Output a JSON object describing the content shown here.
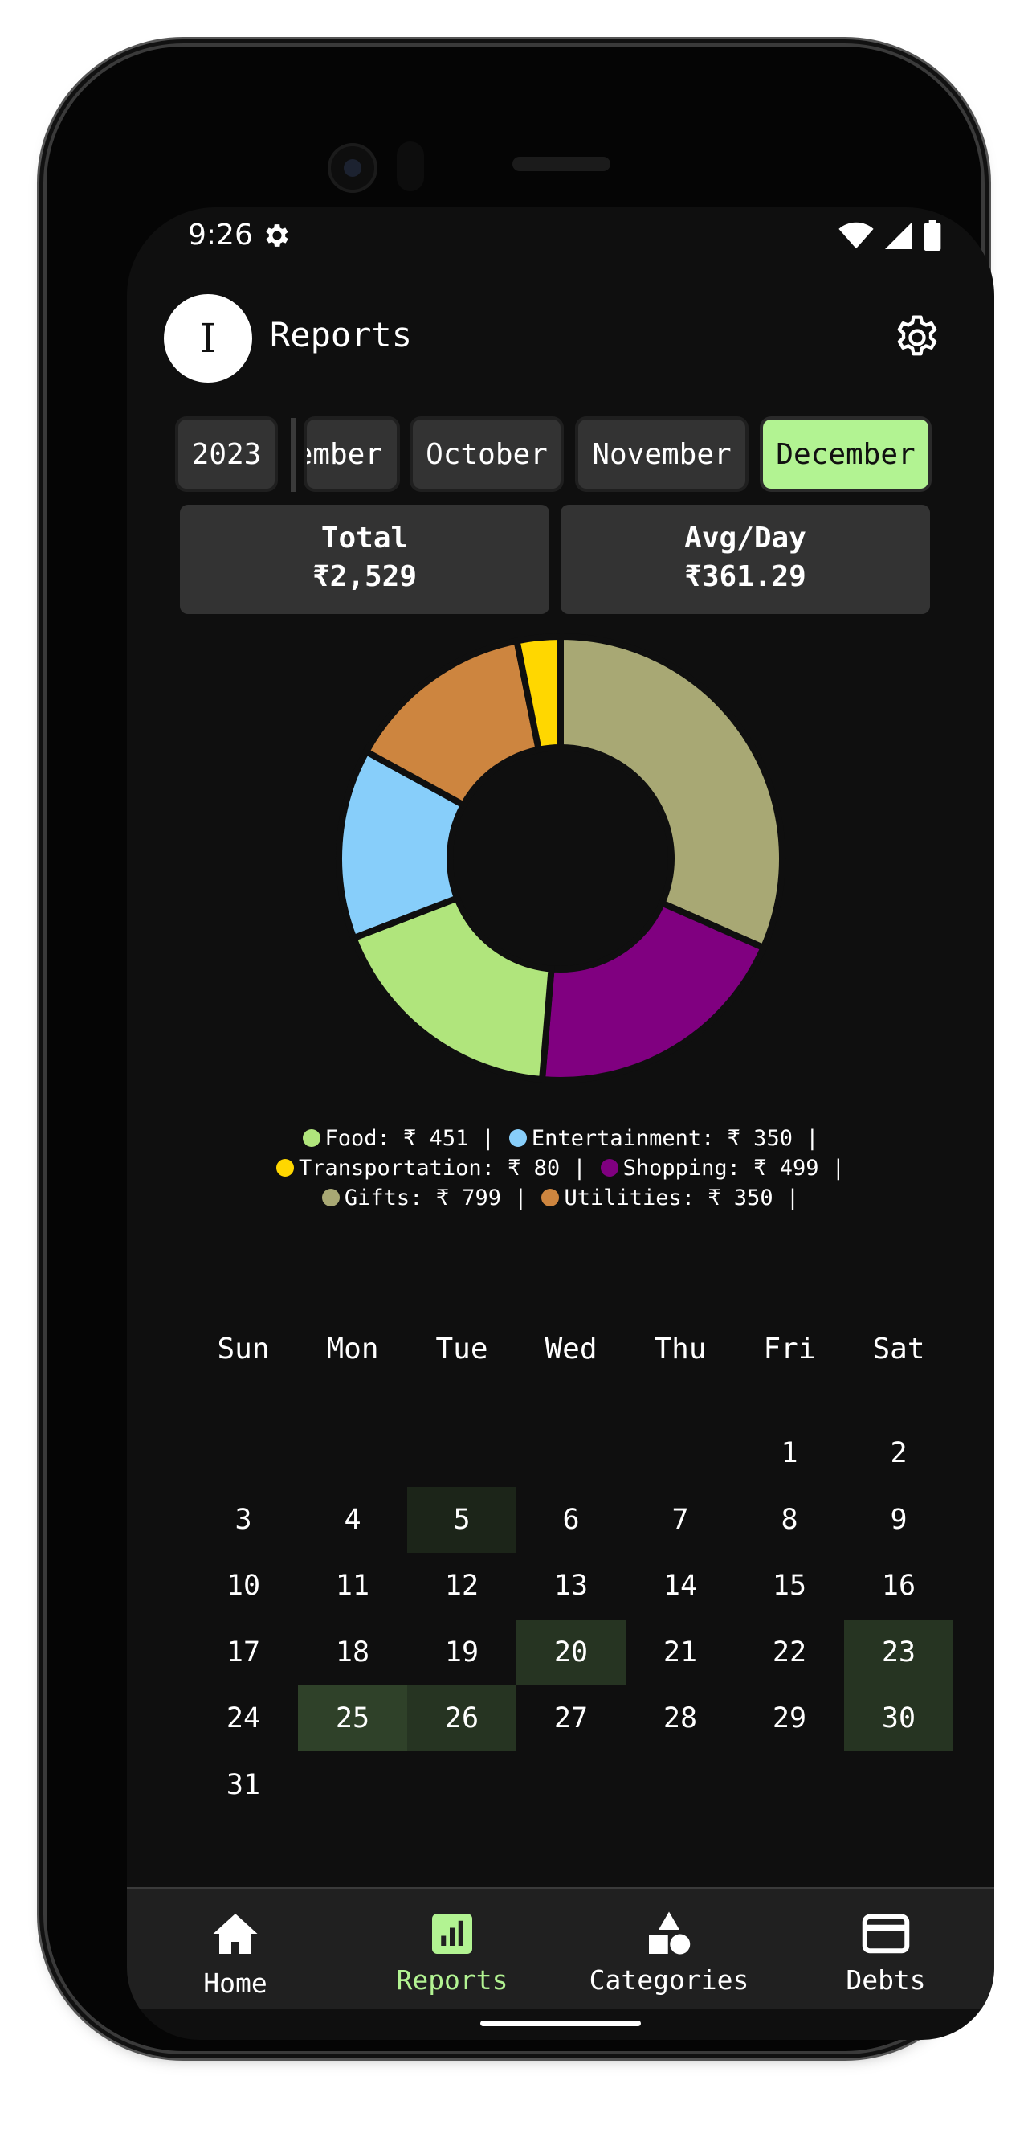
{
  "status_bar": {
    "time": "9:26"
  },
  "header": {
    "avatar_letter": "I",
    "title": "Reports"
  },
  "period": {
    "year": "2023",
    "months": [
      "ember",
      "October",
      "November",
      "December"
    ],
    "selected": "December"
  },
  "stats": {
    "total_label": "Total",
    "total_value": "₹2,529",
    "avg_label": "Avg/Day",
    "avg_value": "₹361.29"
  },
  "chart_data": {
    "type": "pie",
    "donut": true,
    "slices": [
      {
        "label": "Gifts",
        "value": 799,
        "color": "#a8a874"
      },
      {
        "label": "Shopping",
        "value": 499,
        "color": "#800080"
      },
      {
        "label": "Food",
        "value": 451,
        "color": "#b0e57c"
      },
      {
        "label": "Entertainment",
        "value": 350,
        "color": "#87cefa"
      },
      {
        "label": "Utilities",
        "value": 350,
        "color": "#cd853f"
      },
      {
        "label": "Transportation",
        "value": 80,
        "color": "#ffd700"
      }
    ]
  },
  "legend": {
    "rows": [
      [
        {
          "text": "Food: ₹ 451 |",
          "color": "#b0e57c"
        },
        {
          "text": "Entertainment: ₹ 350 |",
          "color": "#87cefa"
        }
      ],
      [
        {
          "text": "Transportation: ₹ 80 |",
          "color": "#ffd700"
        },
        {
          "text": "Shopping: ₹ 499 |",
          "color": "#800080"
        }
      ],
      [
        {
          "text": "Gifts: ₹ 799 |",
          "color": "#a8a874"
        },
        {
          "text": "Utilities: ₹ 350 |",
          "color": "#cd853f"
        }
      ]
    ]
  },
  "calendar": {
    "weekdays": [
      "Sun",
      "Mon",
      "Tue",
      "Wed",
      "Thu",
      "Fri",
      "Sat"
    ],
    "first_weekday": 5,
    "days_in_month": 31,
    "highlight_days": [
      5,
      20,
      23,
      25,
      26,
      30
    ]
  },
  "nav": {
    "items": [
      {
        "label": "Home",
        "icon": "home-icon"
      },
      {
        "label": "Reports",
        "icon": "reports-icon"
      },
      {
        "label": "Categories",
        "icon": "categories-icon"
      },
      {
        "label": "Debts",
        "icon": "credit-card-icon"
      }
    ],
    "active": "Reports",
    "active_color": "#b2f392"
  }
}
